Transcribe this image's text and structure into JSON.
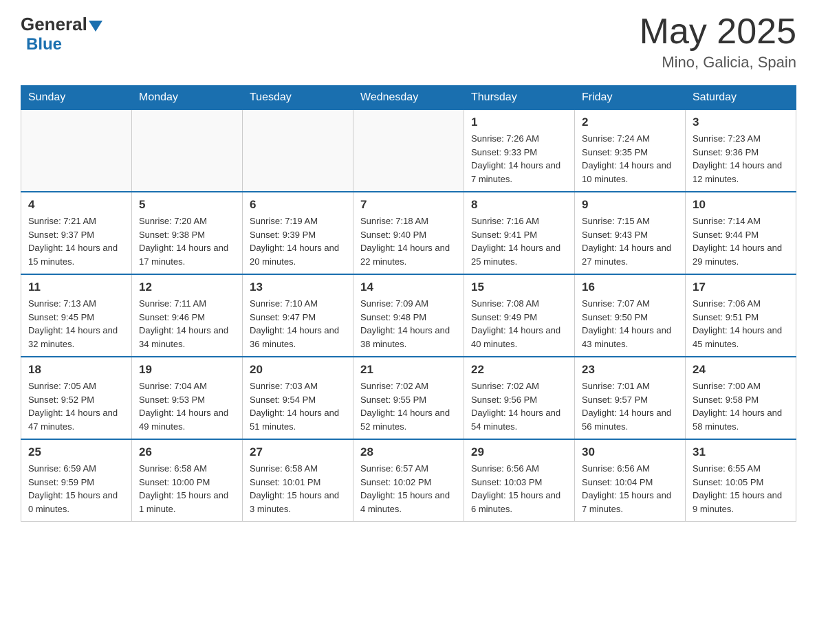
{
  "header": {
    "logo_general": "General",
    "logo_blue": "Blue",
    "month_year": "May 2025",
    "location": "Mino, Galicia, Spain"
  },
  "days_of_week": [
    "Sunday",
    "Monday",
    "Tuesday",
    "Wednesday",
    "Thursday",
    "Friday",
    "Saturday"
  ],
  "weeks": [
    [
      {
        "day": "",
        "info": ""
      },
      {
        "day": "",
        "info": ""
      },
      {
        "day": "",
        "info": ""
      },
      {
        "day": "",
        "info": ""
      },
      {
        "day": "1",
        "info": "Sunrise: 7:26 AM\nSunset: 9:33 PM\nDaylight: 14 hours and 7 minutes."
      },
      {
        "day": "2",
        "info": "Sunrise: 7:24 AM\nSunset: 9:35 PM\nDaylight: 14 hours and 10 minutes."
      },
      {
        "day": "3",
        "info": "Sunrise: 7:23 AM\nSunset: 9:36 PM\nDaylight: 14 hours and 12 minutes."
      }
    ],
    [
      {
        "day": "4",
        "info": "Sunrise: 7:21 AM\nSunset: 9:37 PM\nDaylight: 14 hours and 15 minutes."
      },
      {
        "day": "5",
        "info": "Sunrise: 7:20 AM\nSunset: 9:38 PM\nDaylight: 14 hours and 17 minutes."
      },
      {
        "day": "6",
        "info": "Sunrise: 7:19 AM\nSunset: 9:39 PM\nDaylight: 14 hours and 20 minutes."
      },
      {
        "day": "7",
        "info": "Sunrise: 7:18 AM\nSunset: 9:40 PM\nDaylight: 14 hours and 22 minutes."
      },
      {
        "day": "8",
        "info": "Sunrise: 7:16 AM\nSunset: 9:41 PM\nDaylight: 14 hours and 25 minutes."
      },
      {
        "day": "9",
        "info": "Sunrise: 7:15 AM\nSunset: 9:43 PM\nDaylight: 14 hours and 27 minutes."
      },
      {
        "day": "10",
        "info": "Sunrise: 7:14 AM\nSunset: 9:44 PM\nDaylight: 14 hours and 29 minutes."
      }
    ],
    [
      {
        "day": "11",
        "info": "Sunrise: 7:13 AM\nSunset: 9:45 PM\nDaylight: 14 hours and 32 minutes."
      },
      {
        "day": "12",
        "info": "Sunrise: 7:11 AM\nSunset: 9:46 PM\nDaylight: 14 hours and 34 minutes."
      },
      {
        "day": "13",
        "info": "Sunrise: 7:10 AM\nSunset: 9:47 PM\nDaylight: 14 hours and 36 minutes."
      },
      {
        "day": "14",
        "info": "Sunrise: 7:09 AM\nSunset: 9:48 PM\nDaylight: 14 hours and 38 minutes."
      },
      {
        "day": "15",
        "info": "Sunrise: 7:08 AM\nSunset: 9:49 PM\nDaylight: 14 hours and 40 minutes."
      },
      {
        "day": "16",
        "info": "Sunrise: 7:07 AM\nSunset: 9:50 PM\nDaylight: 14 hours and 43 minutes."
      },
      {
        "day": "17",
        "info": "Sunrise: 7:06 AM\nSunset: 9:51 PM\nDaylight: 14 hours and 45 minutes."
      }
    ],
    [
      {
        "day": "18",
        "info": "Sunrise: 7:05 AM\nSunset: 9:52 PM\nDaylight: 14 hours and 47 minutes."
      },
      {
        "day": "19",
        "info": "Sunrise: 7:04 AM\nSunset: 9:53 PM\nDaylight: 14 hours and 49 minutes."
      },
      {
        "day": "20",
        "info": "Sunrise: 7:03 AM\nSunset: 9:54 PM\nDaylight: 14 hours and 51 minutes."
      },
      {
        "day": "21",
        "info": "Sunrise: 7:02 AM\nSunset: 9:55 PM\nDaylight: 14 hours and 52 minutes."
      },
      {
        "day": "22",
        "info": "Sunrise: 7:02 AM\nSunset: 9:56 PM\nDaylight: 14 hours and 54 minutes."
      },
      {
        "day": "23",
        "info": "Sunrise: 7:01 AM\nSunset: 9:57 PM\nDaylight: 14 hours and 56 minutes."
      },
      {
        "day": "24",
        "info": "Sunrise: 7:00 AM\nSunset: 9:58 PM\nDaylight: 14 hours and 58 minutes."
      }
    ],
    [
      {
        "day": "25",
        "info": "Sunrise: 6:59 AM\nSunset: 9:59 PM\nDaylight: 15 hours and 0 minutes."
      },
      {
        "day": "26",
        "info": "Sunrise: 6:58 AM\nSunset: 10:00 PM\nDaylight: 15 hours and 1 minute."
      },
      {
        "day": "27",
        "info": "Sunrise: 6:58 AM\nSunset: 10:01 PM\nDaylight: 15 hours and 3 minutes."
      },
      {
        "day": "28",
        "info": "Sunrise: 6:57 AM\nSunset: 10:02 PM\nDaylight: 15 hours and 4 minutes."
      },
      {
        "day": "29",
        "info": "Sunrise: 6:56 AM\nSunset: 10:03 PM\nDaylight: 15 hours and 6 minutes."
      },
      {
        "day": "30",
        "info": "Sunrise: 6:56 AM\nSunset: 10:04 PM\nDaylight: 15 hours and 7 minutes."
      },
      {
        "day": "31",
        "info": "Sunrise: 6:55 AM\nSunset: 10:05 PM\nDaylight: 15 hours and 9 minutes."
      }
    ]
  ]
}
